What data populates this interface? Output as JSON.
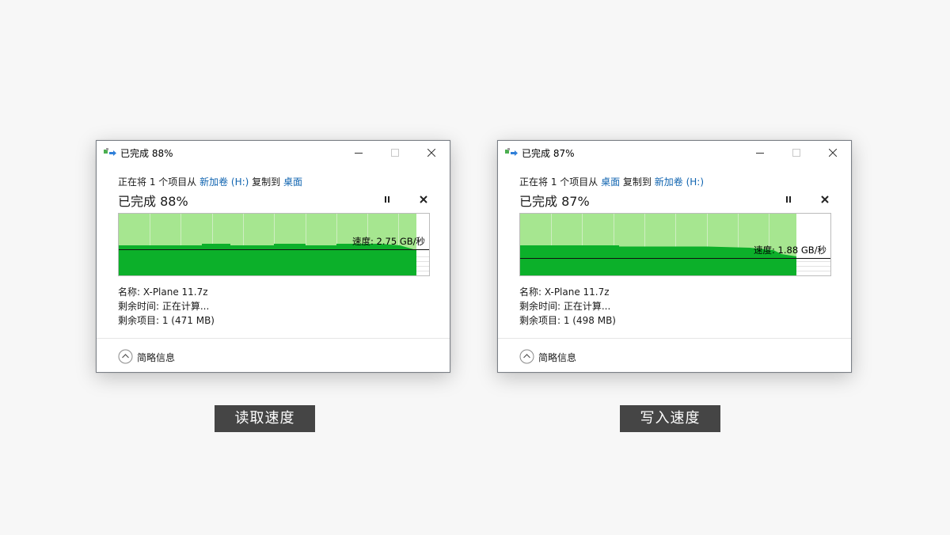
{
  "colors": {
    "graph_fill": "#a6e690",
    "graph_dark": "#0cb02a",
    "link": "#1064b0",
    "caption_bg": "#454545"
  },
  "icons": {
    "app": "copy-files-icon",
    "minimize": "minimize-icon",
    "maximize": "maximize-icon",
    "close": "close-icon",
    "pause": "pause-icon",
    "cancel": "cancel-icon",
    "collapse": "chevron-up-circle-icon"
  },
  "read": {
    "window_title": "已完成 88%",
    "copy_prefix": "正在将 1 个项目从 ",
    "source": "新加卷 (H:)",
    "copy_middle": " 复制到 ",
    "destination": "桌面",
    "progress_title": "已完成 88%",
    "progress_percent": 88,
    "speed_text": "速度: 2.75 GB/秒",
    "name_label": "名称: ",
    "name_value": "X-Plane 11.7z",
    "time_label": "剩余时间: ",
    "time_value": "正在计算...",
    "items_label": "剩余项目: ",
    "items_value": "1 (471 MB)",
    "details_label": "简略信息",
    "caption": "读取速度"
  },
  "write": {
    "window_title": "已完成 87%",
    "copy_prefix": "正在将 1 个项目从 ",
    "source": "桌面",
    "copy_middle": " 复制到 ",
    "destination": "新加卷 (H:)",
    "progress_title": "已完成 87%",
    "progress_percent": 87,
    "speed_text": "速度: 1.88 GB/秒",
    "name_label": "名称: ",
    "name_value": "X-Plane 11.7z",
    "time_label": "剩余时间: ",
    "time_value": "正在计算...",
    "items_label": "剩余项目: ",
    "items_value": "1 (498 MB)",
    "details_label": "简略信息",
    "caption": "写入速度"
  }
}
